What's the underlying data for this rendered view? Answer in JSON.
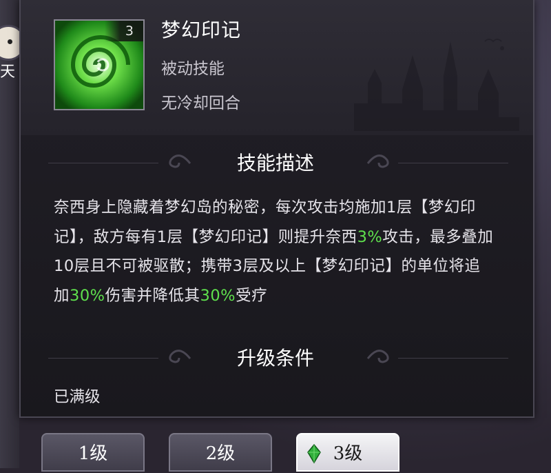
{
  "side": {
    "label": "天"
  },
  "skill": {
    "name": "梦幻印记",
    "type": "被动技能",
    "cooldown": "无冷却回合",
    "level": "3",
    "icon": "green-swirl-icon"
  },
  "sections": {
    "description_title": "技能描述",
    "upgrade_title": "升级条件"
  },
  "description": {
    "segments": [
      {
        "text": "奈西身上隐藏着梦幻岛的秘密，每次攻击均施加1层【梦幻印记】，敌方每有1层【梦幻印记】则提升奈西",
        "highlight": false
      },
      {
        "text": "3%",
        "highlight": true
      },
      {
        "text": "攻击，最多叠加10层且不可被驱散；携带3层及以上【梦幻印记】的单位将追加",
        "highlight": false
      },
      {
        "text": "30%",
        "highlight": true
      },
      {
        "text": "伤害并降低其",
        "highlight": false
      },
      {
        "text": "30%",
        "highlight": true
      },
      {
        "text": "受疗",
        "highlight": false
      }
    ]
  },
  "upgrade": {
    "text": "已满级"
  },
  "tabs": [
    {
      "label": "1级",
      "selected": false
    },
    {
      "label": "2级",
      "selected": false
    },
    {
      "label": "3级",
      "selected": true
    }
  ],
  "colors": {
    "highlight": "#5fe04d",
    "panel": "#1f1d24",
    "tab_selected": "#f4f4f6"
  }
}
